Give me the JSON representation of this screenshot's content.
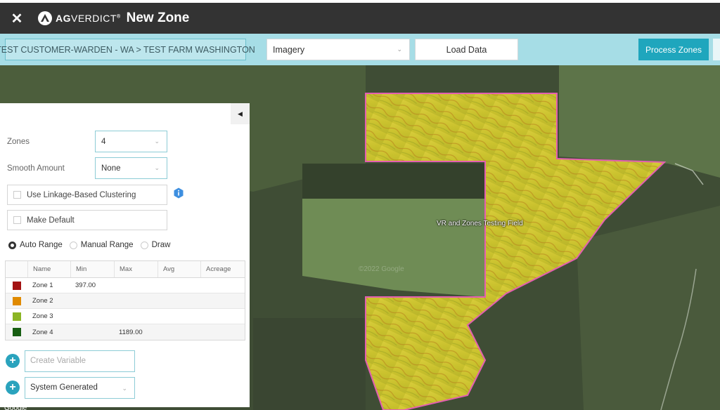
{
  "app": {
    "close_glyph": "✕",
    "brand_bold": "AG",
    "brand_rest": "VERDICT",
    "brand_mark": "®",
    "title": "New Zone"
  },
  "toolbar": {
    "breadcrumb": "TEST CUSTOMER-WARDEN - WA > TEST FARM WASHINGTON",
    "imagery_value": "Imagery",
    "load_label": "Load Data",
    "process_label": "Process Zones"
  },
  "map": {
    "field_label": "VR and Zones Testing Field",
    "watermark": "©2022 Google",
    "attribution": "Google"
  },
  "panel": {
    "zones_label": "Zones",
    "zones_value": "4",
    "smooth_label": "Smooth Amount",
    "smooth_value": "None",
    "linkage_label": "Use Linkage-Based Clustering",
    "default_label": "Make Default",
    "range_options": [
      "Auto Range",
      "Manual Range",
      "Draw"
    ],
    "range_selected": "Auto Range",
    "table": {
      "columns": [
        "",
        "Name",
        "Min",
        "Max",
        "Avg",
        "Acreage"
      ],
      "rows": [
        {
          "color": "#a31212",
          "name": "Zone 1",
          "min": "397.00",
          "max": "",
          "avg": "",
          "acreage": ""
        },
        {
          "color": "#e08a00",
          "name": "Zone 2",
          "min": "",
          "max": "",
          "avg": "",
          "acreage": ""
        },
        {
          "color": "#8bb524",
          "name": "Zone 3",
          "min": "",
          "max": "",
          "avg": "",
          "acreage": ""
        },
        {
          "color": "#175e12",
          "name": "Zone 4",
          "min": "",
          "max": "1189.00",
          "avg": "",
          "acreage": ""
        }
      ]
    },
    "create_variable_placeholder": "Create Variable",
    "system_generated_value": "System Generated"
  },
  "colors": {
    "accent": "#1fa6bd",
    "toolbar": "#a6dde6",
    "field_outline": "#e35fb0"
  }
}
